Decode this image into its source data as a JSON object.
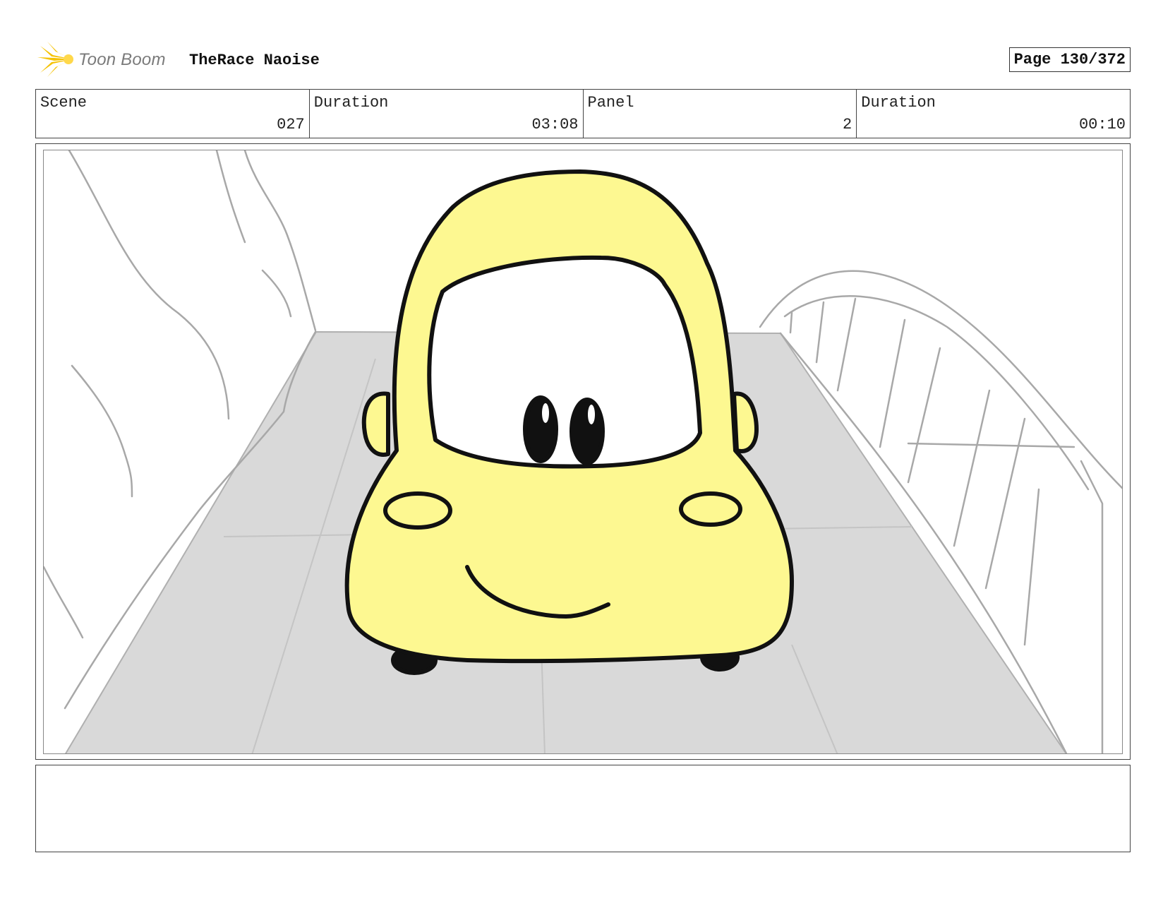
{
  "header": {
    "brand": "Toon Boom",
    "project_title": "TheRace Naoise",
    "page_label": "Page 130/372"
  },
  "info": {
    "scene_label": "Scene",
    "scene_value": "027",
    "scene_duration_label": "Duration",
    "scene_duration_value": "03:08",
    "panel_label": "Panel",
    "panel_value": "2",
    "panel_duration_label": "Duration",
    "panel_duration_value": "00:10"
  },
  "colors": {
    "car_body": "#fdf891",
    "road": "#d9d9d9",
    "sketch_lines": "#a8a8a8",
    "logo_accent": "#f5c200"
  },
  "notes": {
    "text": ""
  }
}
